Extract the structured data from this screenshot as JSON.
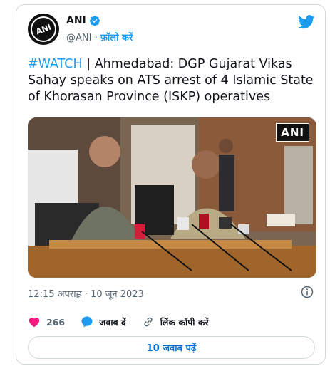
{
  "author": {
    "name": "ANI",
    "handle": "@ANI",
    "separator": "·",
    "follow_label": "फ़ॉलो करें",
    "avatar_text": "ANI"
  },
  "tweet": {
    "hashtag": "#WATCH",
    "text": " | Ahmedabad: DGP Gujarat Vikas Sahay speaks on ATS arrest of 4 Islamic State of Khorasan Province (ISKP) operatives"
  },
  "media": {
    "watermark": "ANI"
  },
  "meta": {
    "timestamp": "12:15 अपराह्न · 10 जून 2023"
  },
  "actions": {
    "likes": "266",
    "reply_label": "जवाब दें",
    "copy_link_label": "लिंक कॉपी करें"
  },
  "replies_button": "10 जवाब पढ़ें",
  "colors": {
    "accent": "#1d9bf0",
    "like": "#f91880",
    "border": "#cfd9de",
    "muted": "#536471"
  }
}
